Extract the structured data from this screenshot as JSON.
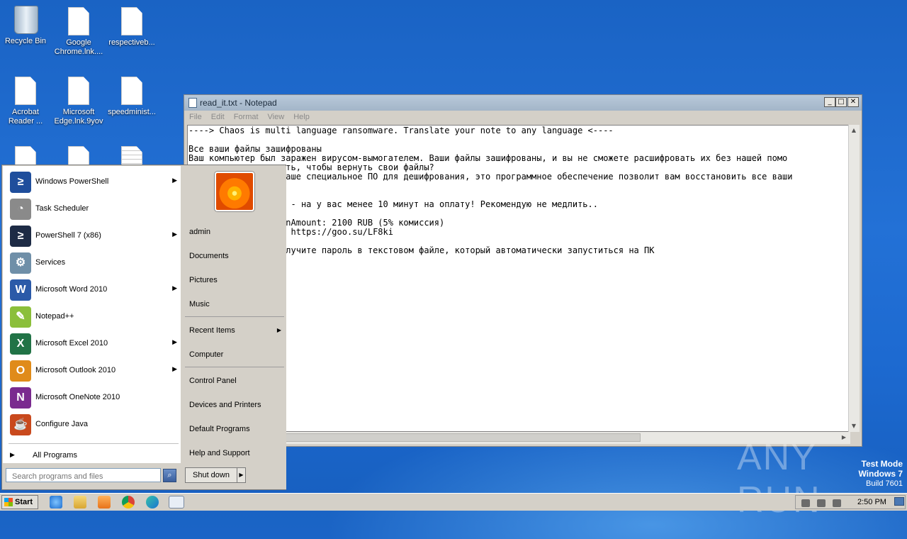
{
  "desktop": {
    "icons": [
      {
        "label": "Recycle Bin"
      },
      {
        "label": "Google Chrome.lnk...."
      },
      {
        "label": "respectiveb..."
      },
      {
        "label": "Acrobat Reader ..."
      },
      {
        "label": "Microsoft Edge.lnk.9yov"
      },
      {
        "label": "speedminist..."
      }
    ]
  },
  "notepad": {
    "title": "read_it.txt - Notepad",
    "menu": [
      "File",
      "Edit",
      "Format",
      "View",
      "Help"
    ],
    "content": "----> Chaos is multi language ransomware. Translate your note to any language <----\n\nВсе ваши файлы зашифрованы\nВаш компьютер был заражен вирусом-вымогателем. Ваши файлы зашифрованы, и вы не сможете расшифровать их без нашей помо\n                  ать, чтобы вернуть свои файлы?\n                  наше специальное ПО для дешифрования, это программное обеспечение позволит вам восстановить все ваши\n\n\n                  3 - на у вас менее 10 минут на оплату! Рекомендую не медлить..\n\n                  onAmount: 2100 RUB (5% комиссия)\n                  : https://goo.su/LF8ki\n\n                  олучите пароль в текстовом файле, который автоматически запуститься на ПК"
  },
  "start_menu": {
    "programs": [
      {
        "label": "Windows PowerShell",
        "submenu": true,
        "icon": "powershell-icon",
        "color": "#1f4e9c",
        "glyph": "≥"
      },
      {
        "label": "Task Scheduler",
        "submenu": false,
        "icon": "clock-icon",
        "color": "#8a8a8a",
        "glyph": "◔"
      },
      {
        "label": "PowerShell 7 (x86)",
        "submenu": true,
        "icon": "powershell7-icon",
        "color": "#1d2b45",
        "glyph": "≥"
      },
      {
        "label": "Services",
        "submenu": false,
        "icon": "gears-icon",
        "color": "#6f8fa8",
        "glyph": "⚙"
      },
      {
        "label": "Microsoft Word 2010",
        "submenu": true,
        "icon": "word-icon",
        "color": "#2b5aa8",
        "glyph": "W"
      },
      {
        "label": "Notepad++",
        "submenu": false,
        "icon": "notepadpp-icon",
        "color": "#8bbf3a",
        "glyph": "✎"
      },
      {
        "label": "Microsoft Excel 2010",
        "submenu": true,
        "icon": "excel-icon",
        "color": "#217346",
        "glyph": "X"
      },
      {
        "label": "Microsoft Outlook 2010",
        "submenu": true,
        "icon": "outlook-icon",
        "color": "#e08b1a",
        "glyph": "O"
      },
      {
        "label": "Microsoft OneNote 2010",
        "submenu": false,
        "icon": "onenote-icon",
        "color": "#7a2a8f",
        "glyph": "N"
      },
      {
        "label": "Configure Java",
        "submenu": false,
        "icon": "java-icon",
        "color": "#c9491d",
        "glyph": "☕"
      }
    ],
    "all_programs": "All Programs",
    "search_placeholder": "Search programs and files",
    "right_links": [
      {
        "label": "admin"
      },
      {
        "label": "Documents"
      },
      {
        "label": "Pictures"
      },
      {
        "label": "Music"
      },
      {
        "label": "Recent Items",
        "submenu": true
      },
      {
        "label": "Computer"
      },
      {
        "label": "Control Panel"
      },
      {
        "label": "Devices and Printers"
      },
      {
        "label": "Default Programs"
      },
      {
        "label": "Help and Support"
      }
    ],
    "shutdown_label": "Shut down"
  },
  "watermark": "ANY RUN",
  "test_mode": {
    "line1": "Test Mode",
    "line2": "Windows 7",
    "line3": "Build 7601"
  },
  "taskbar": {
    "start_label": "Start",
    "clock": "2:50 PM"
  }
}
